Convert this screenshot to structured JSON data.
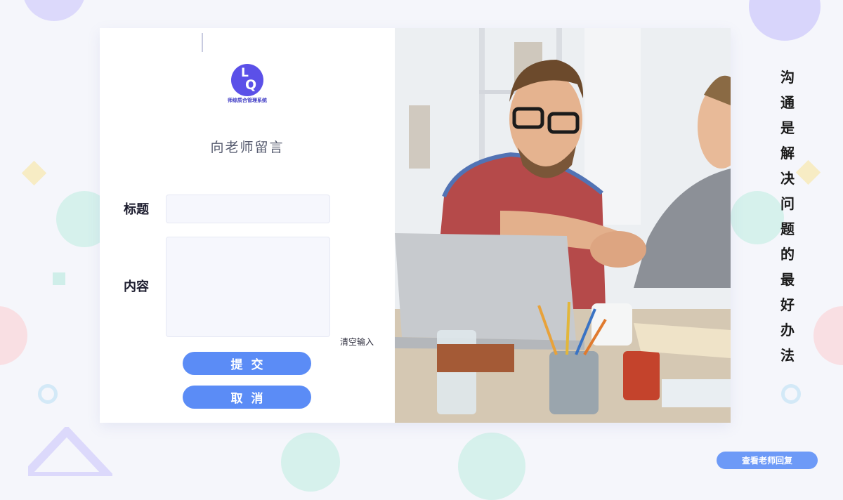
{
  "form": {
    "logo_letters": [
      "L",
      "Q"
    ],
    "logo_caption": "师综质合管理系统",
    "title": "向老师留言",
    "subject_label": "标题",
    "subject_value": "",
    "content_label": "内容",
    "content_value": "",
    "clear_label": "清空输入",
    "submit_label": "提交",
    "cancel_label": "取消"
  },
  "slogan": [
    "沟",
    "通",
    "是",
    "解",
    "决",
    "问",
    "题",
    "的",
    "最",
    "好",
    "办",
    "法"
  ],
  "reply_button_label": "查看老师回复",
  "colors": {
    "accent": "#5b8cf6",
    "logo": "#5b50e8",
    "background": "#f5f6fb"
  }
}
